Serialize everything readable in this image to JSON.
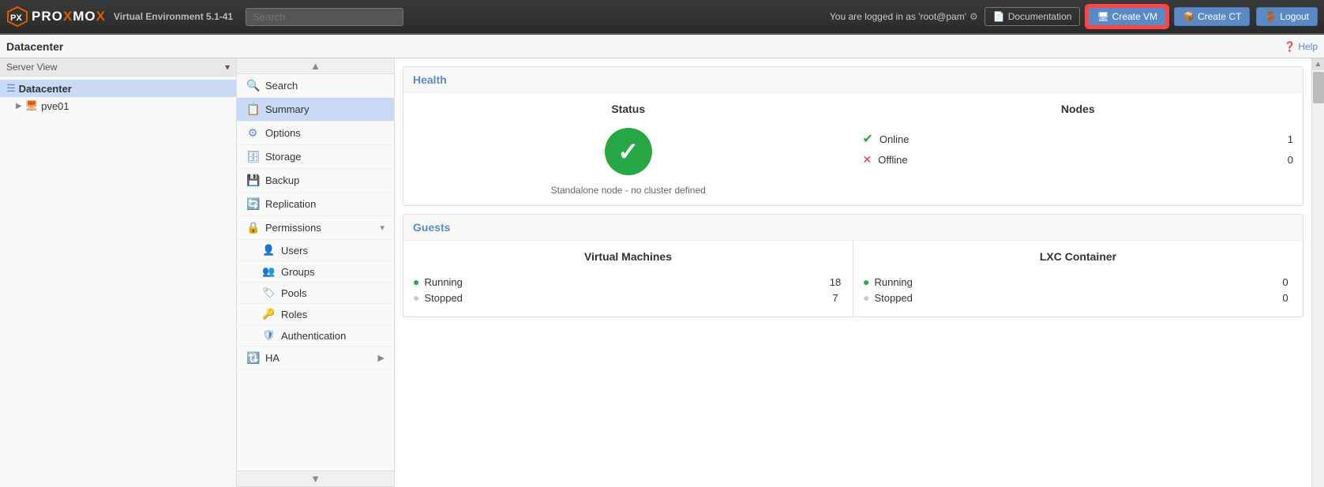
{
  "header": {
    "logo_text": "PROXMOX",
    "logo_m": "M",
    "version": "Virtual Environment 5.1-41",
    "search_placeholder": "Search",
    "user_text": "You are logged in as 'root@pam'",
    "doc_btn": "Documentation",
    "create_vm_btn": "Create VM",
    "create_ct_btn": "Create CT",
    "logout_btn": "Logout"
  },
  "toolbar": {
    "title": "Datacenter",
    "help_btn": "Help"
  },
  "sidebar": {
    "view_label": "Server View",
    "datacenter_label": "Datacenter",
    "node_label": "pve01"
  },
  "nav": {
    "items": [
      {
        "id": "search",
        "label": "Search",
        "icon": "🔍"
      },
      {
        "id": "summary",
        "label": "Summary",
        "icon": "📋",
        "active": true
      },
      {
        "id": "options",
        "label": "Options",
        "icon": "⚙️"
      },
      {
        "id": "storage",
        "label": "Storage",
        "icon": "🗄️"
      },
      {
        "id": "backup",
        "label": "Backup",
        "icon": "💾"
      },
      {
        "id": "replication",
        "label": "Replication",
        "icon": "🔄"
      },
      {
        "id": "permissions",
        "label": "Permissions",
        "icon": "🔒",
        "has_submenu": true
      },
      {
        "id": "users",
        "label": "Users",
        "icon": "👤",
        "sub": true
      },
      {
        "id": "groups",
        "label": "Groups",
        "icon": "👥",
        "sub": true
      },
      {
        "id": "pools",
        "label": "Pools",
        "icon": "🏷️",
        "sub": true
      },
      {
        "id": "roles",
        "label": "Roles",
        "icon": "🔑",
        "sub": true
      },
      {
        "id": "authentication",
        "label": "Authentication",
        "icon": "🛡️",
        "sub": true
      },
      {
        "id": "ha",
        "label": "HA",
        "icon": "🔃",
        "has_submenu": true
      }
    ]
  },
  "health": {
    "section_title": "Health",
    "status_col_title": "Status",
    "standalone_text": "Standalone node - no cluster defined",
    "nodes_col_title": "Nodes",
    "online_label": "Online",
    "online_count": "1",
    "offline_label": "Offline",
    "offline_count": "0"
  },
  "guests": {
    "section_title": "Guests",
    "vm_col_title": "Virtual Machines",
    "vm_running_label": "Running",
    "vm_running_count": "18",
    "vm_stopped_label": "Stopped",
    "vm_stopped_count": "7",
    "lxc_col_title": "LXC Container",
    "lxc_running_label": "Running",
    "lxc_running_count": "0",
    "lxc_stopped_label": "Stopped",
    "lxc_stopped_count": "0"
  },
  "icons": {
    "check": "✓",
    "x": "✕",
    "arrow_up": "▲",
    "arrow_down": "▼",
    "arrow_right": "▶",
    "chevron_right": "›"
  }
}
